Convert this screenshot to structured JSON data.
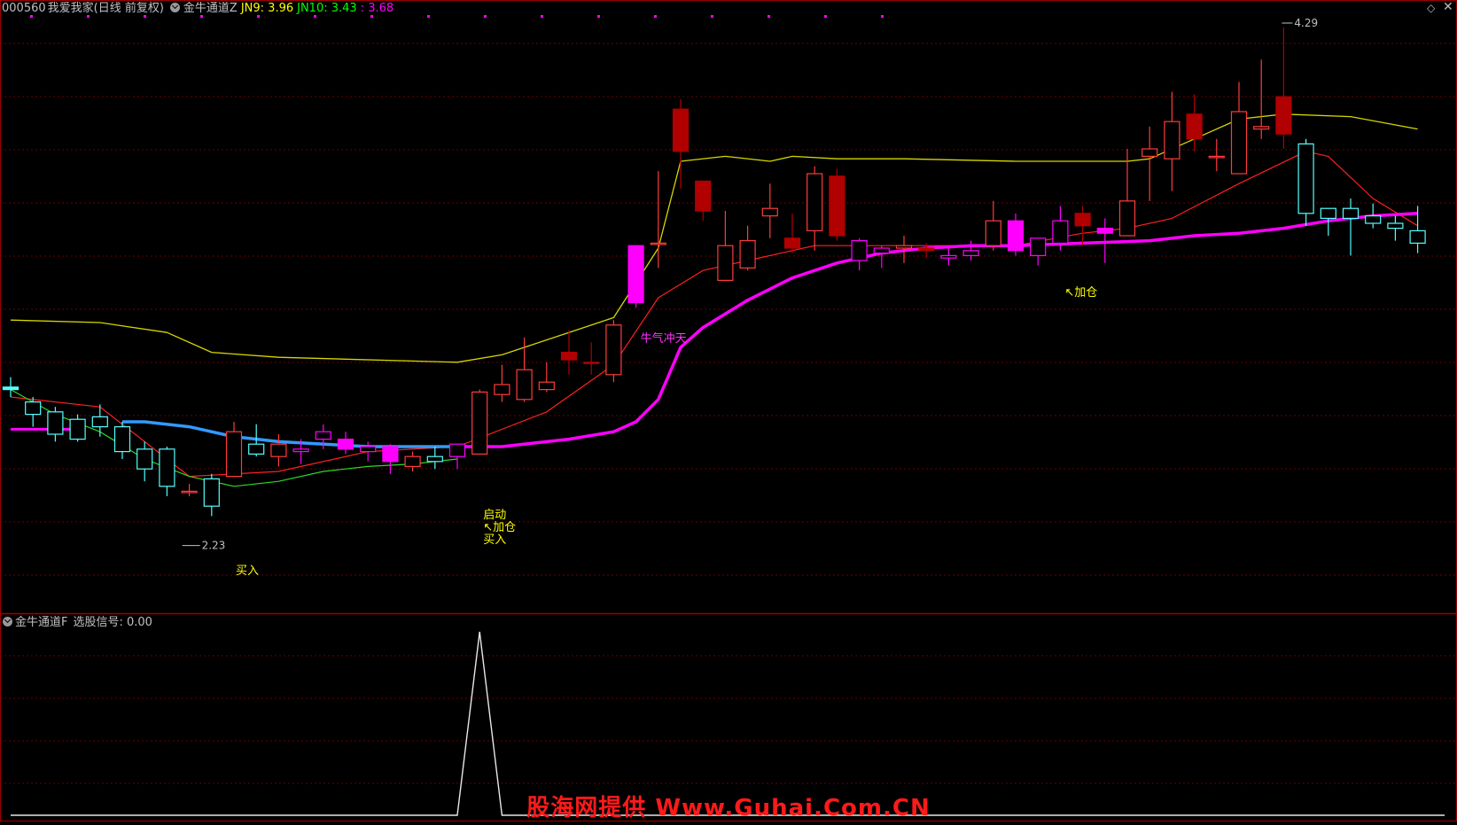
{
  "header": {
    "code": "000560",
    "name": "我爱我家(日线 前复权)",
    "indicator": "金牛通道Z",
    "jn9_label": "JN9: 3.96",
    "jn10_label": "JN10: 3.43",
    "jn11_label": ": 3.68"
  },
  "sub_header": {
    "indicator": "金牛通道F",
    "signal_label": "选股信号: 0.00"
  },
  "watermark": "股海网提供 Www.Guhai.Com.CN",
  "colors": {
    "up": "#ff3b3b",
    "down": "#54ffff",
    "magenta": "#ff00ff",
    "upper_band": "#d6d600",
    "ma_red": "#ff2020",
    "grid": "#6b0000",
    "border": "#a00000",
    "label_yellow": "#ffff00",
    "label_magenta": "#ff33ff",
    "text_gray": "#c0c0c0"
  },
  "chart_data": [
    {
      "type": "candlestick",
      "y_range": [
        2.0,
        4.35
      ],
      "x_count": 64,
      "candles": [
        {
          "o": 2.84,
          "h": 2.88,
          "l": 2.8,
          "c": 2.83,
          "col": "cyan"
        },
        {
          "o": 2.78,
          "h": 2.8,
          "l": 2.68,
          "c": 2.73,
          "col": "down"
        },
        {
          "o": 2.74,
          "h": 2.76,
          "l": 2.62,
          "c": 2.65,
          "col": "down"
        },
        {
          "o": 2.71,
          "h": 2.73,
          "l": 2.62,
          "c": 2.63,
          "col": "down"
        },
        {
          "o": 2.72,
          "h": 2.77,
          "l": 2.64,
          "c": 2.68,
          "col": "down"
        },
        {
          "o": 2.68,
          "h": 2.7,
          "l": 2.55,
          "c": 2.58,
          "col": "down"
        },
        {
          "o": 2.59,
          "h": 2.62,
          "l": 2.46,
          "c": 2.51,
          "col": "down"
        },
        {
          "o": 2.59,
          "h": 2.6,
          "l": 2.4,
          "c": 2.44,
          "col": "down"
        },
        {
          "o": 2.42,
          "h": 2.45,
          "l": 2.4,
          "c": 2.42,
          "col": "up"
        },
        {
          "o": 2.47,
          "h": 2.49,
          "l": 2.32,
          "c": 2.36,
          "col": "down"
        },
        {
          "o": 2.48,
          "h": 2.7,
          "l": 2.48,
          "c": 2.66,
          "col": "up"
        },
        {
          "o": 2.61,
          "h": 2.69,
          "l": 2.56,
          "c": 2.57,
          "col": "down"
        },
        {
          "o": 2.56,
          "h": 2.65,
          "l": 2.52,
          "c": 2.61,
          "col": "dup"
        },
        {
          "o": 2.58,
          "h": 2.63,
          "l": 2.53,
          "c": 2.59,
          "col": "magenta"
        },
        {
          "o": 2.66,
          "h": 2.69,
          "l": 2.59,
          "c": 2.63,
          "col": "magenta"
        },
        {
          "o": 2.59,
          "h": 2.66,
          "l": 2.57,
          "c": 2.63,
          "col": "magsolid"
        },
        {
          "o": 2.6,
          "h": 2.62,
          "l": 2.54,
          "c": 2.58,
          "col": "magenta"
        },
        {
          "o": 2.54,
          "h": 2.61,
          "l": 2.49,
          "c": 2.6,
          "col": "magsolid"
        },
        {
          "o": 2.52,
          "h": 2.58,
          "l": 2.5,
          "c": 2.56,
          "col": "up"
        },
        {
          "o": 2.54,
          "h": 2.6,
          "l": 2.51,
          "c": 2.56,
          "col": "down"
        },
        {
          "o": 2.56,
          "h": 2.61,
          "l": 2.51,
          "c": 2.61,
          "col": "magenta"
        },
        {
          "o": 2.57,
          "h": 2.83,
          "l": 2.57,
          "c": 2.82,
          "col": "up"
        },
        {
          "o": 2.81,
          "h": 2.93,
          "l": 2.78,
          "c": 2.85,
          "col": "dup"
        },
        {
          "o": 2.79,
          "h": 3.04,
          "l": 2.78,
          "c": 2.91,
          "col": "up"
        },
        {
          "o": 2.86,
          "h": 2.94,
          "l": 2.82,
          "c": 2.83,
          "col": "dup"
        },
        {
          "o": 2.98,
          "h": 3.07,
          "l": 2.89,
          "c": 2.95,
          "col": "dupsolid"
        },
        {
          "o": 2.94,
          "h": 3.02,
          "l": 2.89,
          "c": 2.94,
          "col": "dupsolid"
        },
        {
          "o": 2.89,
          "h": 3.11,
          "l": 2.86,
          "c": 3.09,
          "col": "up"
        },
        {
          "o": 3.41,
          "h": 3.41,
          "l": 3.16,
          "c": 3.18,
          "col": "magsolid"
        },
        {
          "o": 3.42,
          "h": 3.71,
          "l": 3.32,
          "c": 3.42,
          "col": "dup"
        },
        {
          "o": 3.96,
          "h": 4.0,
          "l": 3.64,
          "c": 3.79,
          "col": "dupsolid"
        },
        {
          "o": 3.67,
          "h": 3.67,
          "l": 3.51,
          "c": 3.55,
          "col": "dupsolid"
        },
        {
          "o": 3.27,
          "h": 3.55,
          "l": 3.27,
          "c": 3.41,
          "col": "up"
        },
        {
          "o": 3.43,
          "h": 3.49,
          "l": 3.31,
          "c": 3.32,
          "col": "dup"
        },
        {
          "o": 3.56,
          "h": 3.66,
          "l": 3.44,
          "c": 3.53,
          "col": "dup"
        },
        {
          "o": 3.44,
          "h": 3.54,
          "l": 3.38,
          "c": 3.4,
          "col": "dupsolid"
        },
        {
          "o": 3.47,
          "h": 3.73,
          "l": 3.39,
          "c": 3.7,
          "col": "up"
        },
        {
          "o": 3.69,
          "h": 3.72,
          "l": 3.43,
          "c": 3.45,
          "col": "dupsolid"
        },
        {
          "o": 3.35,
          "h": 3.44,
          "l": 3.31,
          "c": 3.43,
          "col": "magenta"
        },
        {
          "o": 3.4,
          "h": 3.41,
          "l": 3.32,
          "c": 3.38,
          "col": "magenta"
        },
        {
          "o": 3.4,
          "h": 3.45,
          "l": 3.34,
          "c": 3.41,
          "col": "up"
        },
        {
          "o": 3.39,
          "h": 3.42,
          "l": 3.36,
          "c": 3.4,
          "col": "dupsolid"
        },
        {
          "o": 3.37,
          "h": 3.4,
          "l": 3.33,
          "c": 3.36,
          "col": "magenta"
        },
        {
          "o": 3.39,
          "h": 3.43,
          "l": 3.35,
          "c": 3.37,
          "col": "magenta"
        },
        {
          "o": 3.41,
          "h": 3.59,
          "l": 3.39,
          "c": 3.51,
          "col": "up"
        },
        {
          "o": 3.51,
          "h": 3.54,
          "l": 3.37,
          "c": 3.39,
          "col": "magsolid"
        },
        {
          "o": 3.37,
          "h": 3.41,
          "l": 3.33,
          "c": 3.44,
          "col": "magenta"
        },
        {
          "o": 3.51,
          "h": 3.57,
          "l": 3.39,
          "c": 3.42,
          "col": "magenta"
        },
        {
          "o": 3.54,
          "h": 3.57,
          "l": 3.41,
          "c": 3.49,
          "col": "dupsolid"
        },
        {
          "o": 3.46,
          "h": 3.52,
          "l": 3.34,
          "c": 3.48,
          "col": "magsolid"
        },
        {
          "o": 3.45,
          "h": 3.8,
          "l": 3.45,
          "c": 3.59,
          "col": "up"
        },
        {
          "o": 3.8,
          "h": 3.89,
          "l": 3.59,
          "c": 3.77,
          "col": "up"
        },
        {
          "o": 3.76,
          "h": 4.03,
          "l": 3.63,
          "c": 3.91,
          "col": "up"
        },
        {
          "o": 3.94,
          "h": 4.02,
          "l": 3.79,
          "c": 3.84,
          "col": "dupsolid"
        },
        {
          "o": 3.77,
          "h": 3.84,
          "l": 3.71,
          "c": 3.77,
          "col": "up"
        },
        {
          "o": 3.7,
          "h": 4.07,
          "l": 3.7,
          "c": 3.95,
          "col": "up"
        },
        {
          "o": 3.88,
          "h": 4.16,
          "l": 3.84,
          "c": 3.89,
          "col": "dup"
        },
        {
          "o": 4.01,
          "h": 4.29,
          "l": 3.8,
          "c": 3.86,
          "col": "dupsolid"
        },
        {
          "o": 3.82,
          "h": 3.84,
          "l": 3.49,
          "c": 3.54,
          "col": "down"
        },
        {
          "o": 3.52,
          "h": 3.56,
          "l": 3.45,
          "c": 3.56,
          "col": "down"
        },
        {
          "o": 3.56,
          "h": 3.6,
          "l": 3.37,
          "c": 3.52,
          "col": "down"
        },
        {
          "o": 3.53,
          "h": 3.58,
          "l": 3.48,
          "c": 3.5,
          "col": "down"
        },
        {
          "o": 3.5,
          "h": 3.53,
          "l": 3.43,
          "c": 3.48,
          "col": "down"
        },
        {
          "o": 3.47,
          "h": 3.57,
          "l": 3.38,
          "c": 3.42,
          "col": "down"
        }
      ],
      "upper_band": [
        [
          0,
          3.11
        ],
        [
          4,
          3.1
        ],
        [
          7,
          3.06
        ],
        [
          9,
          2.98
        ],
        [
          12,
          2.96
        ],
        [
          20,
          2.94
        ],
        [
          22,
          2.97
        ],
        [
          25,
          3.06
        ],
        [
          27,
          3.12
        ],
        [
          29,
          3.4
        ],
        [
          30,
          3.75
        ],
        [
          32,
          3.77
        ],
        [
          34,
          3.75
        ],
        [
          35,
          3.77
        ],
        [
          37,
          3.76
        ],
        [
          40,
          3.76
        ],
        [
          45,
          3.75
        ],
        [
          50,
          3.75
        ],
        [
          51,
          3.76
        ],
        [
          53,
          3.84
        ],
        [
          55,
          3.92
        ],
        [
          57,
          3.94
        ],
        [
          60,
          3.93
        ],
        [
          63,
          3.88
        ]
      ],
      "ma_red": [
        [
          0,
          2.8
        ],
        [
          4,
          2.76
        ],
        [
          8,
          2.48
        ],
        [
          12,
          2.5
        ],
        [
          16,
          2.58
        ],
        [
          20,
          2.6
        ],
        [
          24,
          2.74
        ],
        [
          27,
          2.93
        ],
        [
          29,
          3.2
        ],
        [
          31,
          3.31
        ],
        [
          33,
          3.35
        ],
        [
          36,
          3.41
        ],
        [
          40,
          3.41
        ],
        [
          45,
          3.41
        ],
        [
          48,
          3.46
        ],
        [
          50,
          3.48
        ],
        [
          52,
          3.52
        ],
        [
          55,
          3.66
        ],
        [
          58,
          3.79
        ],
        [
          59,
          3.77
        ],
        [
          61,
          3.6
        ],
        [
          63,
          3.49
        ]
      ],
      "wave_line": [
        [
          0,
          2.67
        ],
        [
          3,
          2.67
        ],
        [
          5,
          2.7
        ],
        [
          6,
          2.7
        ],
        [
          8,
          2.68
        ],
        [
          10,
          2.64
        ],
        [
          12,
          2.62
        ],
        [
          16,
          2.6
        ],
        [
          20,
          2.6
        ],
        [
          22,
          2.6
        ],
        [
          25,
          2.63
        ],
        [
          27,
          2.66
        ],
        [
          28,
          2.7
        ],
        [
          29,
          2.79
        ],
        [
          30,
          3.0
        ],
        [
          31,
          3.08
        ],
        [
          33,
          3.19
        ],
        [
          35,
          3.28
        ],
        [
          37,
          3.34
        ],
        [
          39,
          3.38
        ],
        [
          41,
          3.4
        ],
        [
          43,
          3.41
        ],
        [
          45,
          3.41
        ],
        [
          48,
          3.42
        ],
        [
          51,
          3.43
        ],
        [
          53,
          3.45
        ],
        [
          55,
          3.46
        ],
        [
          57,
          3.48
        ],
        [
          59,
          3.51
        ],
        [
          61,
          3.53
        ],
        [
          63,
          3.54
        ]
      ],
      "labels": [
        {
          "i": 8,
          "text": "2.23",
          "kind": "low"
        },
        {
          "i": 10,
          "text": "买入",
          "kind": "buy"
        },
        {
          "i": 21,
          "text": "启动",
          "kind": "start"
        },
        {
          "i": 21,
          "text": "↖加仓",
          "kind": "add"
        },
        {
          "i": 21,
          "text": "买入",
          "kind": "buy2"
        },
        {
          "i": 28,
          "text": "牛气冲天",
          "kind": "bull"
        },
        {
          "i": 47,
          "text": "↖加仓",
          "kind": "add2"
        },
        {
          "i": 57,
          "text": "4.29",
          "kind": "high"
        }
      ]
    },
    {
      "type": "line",
      "series": [
        {
          "name": "选股信号",
          "x": [
            0,
            20,
            21,
            22,
            63
          ],
          "values": [
            0,
            0,
            1,
            0,
            0
          ]
        }
      ],
      "ylim": [
        0,
        1
      ]
    }
  ]
}
